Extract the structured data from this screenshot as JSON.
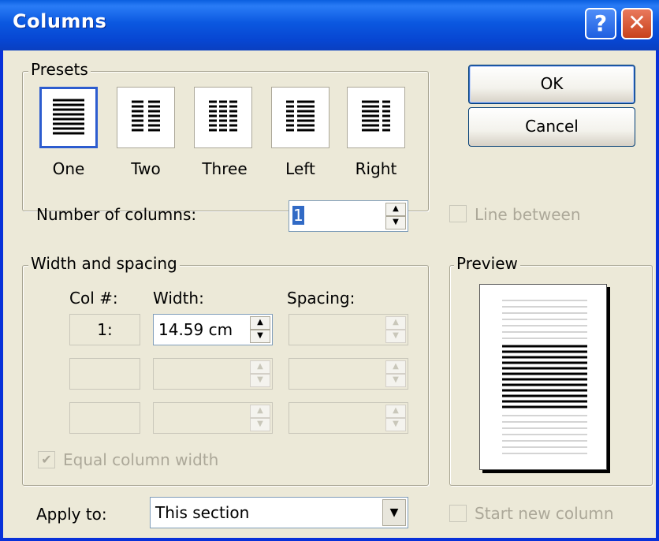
{
  "window": {
    "title": "Columns"
  },
  "title_buttons": {
    "help": "?",
    "close": "✕"
  },
  "presets": {
    "group_label": "Presets",
    "items": [
      {
        "label": "One",
        "mnemonic": "O"
      },
      {
        "label": "Two",
        "mnemonic": "w"
      },
      {
        "label": "Three",
        "mnemonic": "T"
      },
      {
        "label": "Left",
        "mnemonic": "L"
      },
      {
        "label": "Right",
        "mnemonic": "R"
      }
    ],
    "selected": "One"
  },
  "buttons": {
    "ok": "OK",
    "cancel": "Cancel"
  },
  "number_of_columns": {
    "label": "Number of columns:",
    "value": "1"
  },
  "line_between": {
    "label": "Line between",
    "checked": false,
    "enabled": false
  },
  "width_spacing": {
    "group_label": "Width and spacing",
    "headers": {
      "col": "Col #:",
      "width": "Width:",
      "spacing": "Spacing:"
    },
    "rows": [
      {
        "col": "1:",
        "width": "14.59 cm",
        "spacing": ""
      },
      {
        "col": "",
        "width": "",
        "spacing": ""
      },
      {
        "col": "",
        "width": "",
        "spacing": ""
      }
    ]
  },
  "equal_column_width": {
    "label": "Equal column width",
    "checked": true,
    "enabled": false
  },
  "preview": {
    "group_label": "Preview"
  },
  "apply_to": {
    "label": "Apply to:",
    "value": "This section"
  },
  "start_new_column": {
    "label": "Start new column",
    "checked": false,
    "enabled": false
  },
  "spinner_glyphs": {
    "up": "▲",
    "down": "▼",
    "drop": "▼",
    "check": "✔"
  }
}
